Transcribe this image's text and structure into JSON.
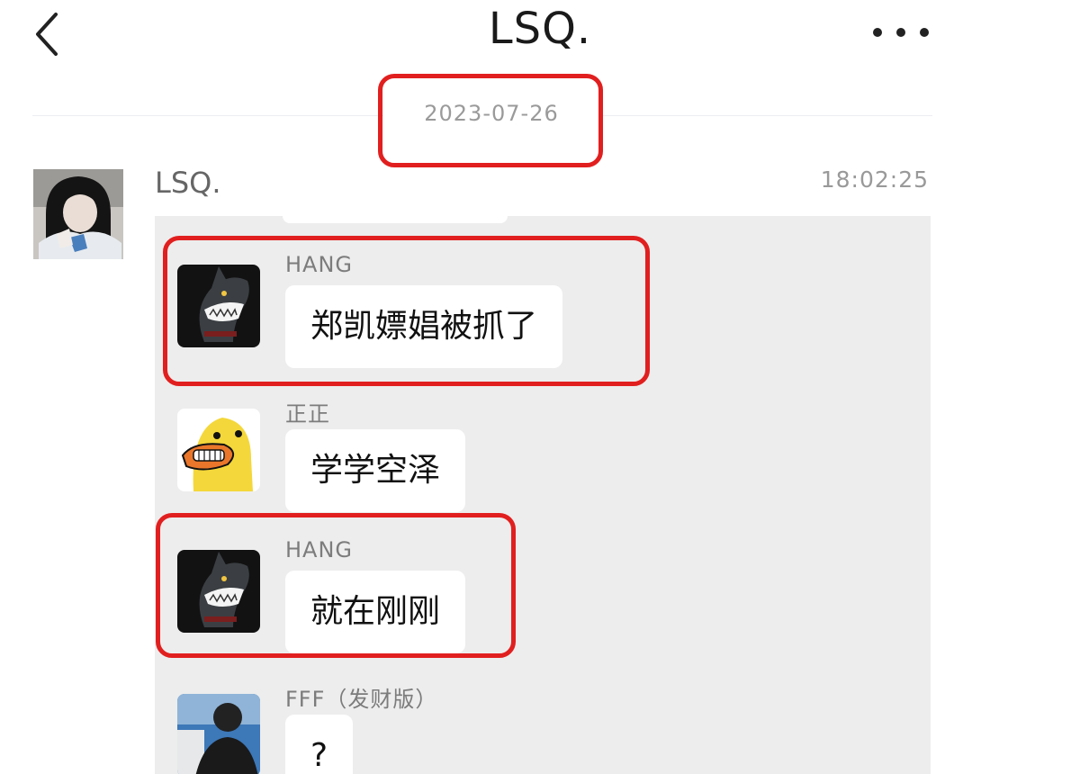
{
  "header": {
    "title": "LSQ."
  },
  "date_divider": "2023-07-26",
  "message": {
    "sender": "LSQ.",
    "time": "18:02:25",
    "forwarded_chat": [
      {
        "name": "HANG",
        "text": "郑凯嫖娼被抓了",
        "avatar": "shark-avatar",
        "highlighted": true
      },
      {
        "name": "正正",
        "text": "学学空泽",
        "avatar": "duck-avatar",
        "highlighted": false
      },
      {
        "name": "HANG",
        "text": "就在刚刚",
        "avatar": "shark-avatar",
        "highlighted": true
      },
      {
        "name": "FFF（发财版）",
        "text": "?",
        "avatar": "photo-avatar",
        "highlighted": false
      }
    ]
  },
  "colors": {
    "highlight": "#e11f1f",
    "card_background": "#ededed",
    "bubble_background": "#ffffff"
  }
}
